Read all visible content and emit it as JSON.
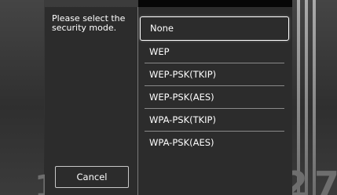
{
  "dialog": {
    "prompt": "Please select the security mode.",
    "options": [
      "None",
      "WEP",
      "WEP-PSK(TKIP)",
      "WEP-PSK(AES)",
      "WPA-PSK(TKIP)",
      "WPA-PSK(AES)"
    ],
    "selected": "None",
    "cancel_label": "Cancel"
  },
  "background": {
    "digit_left": "1",
    "digit_mid": "2",
    "digit_right": "7"
  }
}
